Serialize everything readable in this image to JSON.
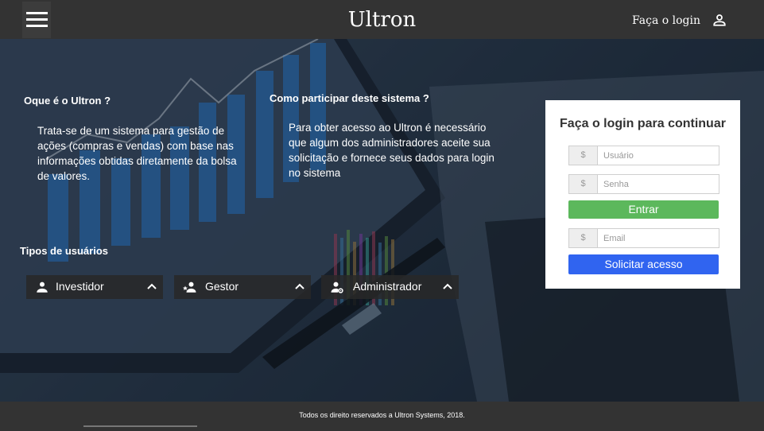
{
  "header": {
    "brand": "Ultron",
    "login_link": "Faça o login"
  },
  "info": {
    "what_title": "Oque é o Ultron ?",
    "what_text_lines": [
      "Trata-se de um sistema para gestão de",
      "ações (compras e vendas) com base nas",
      "informações obtidas diretamente da bolsa",
      "de valores."
    ],
    "how_title": "Como participar deste sistema ?",
    "how_text_lines": [
      "Para obter acesso ao Ultron é necessário",
      "que algum dos administradores aceite sua",
      "solicitação e fornece seus dados para login",
      "no sistema"
    ]
  },
  "user_types": {
    "title": "Tipos de usuários",
    "items": [
      {
        "label": "Investidor",
        "icon": "person-icon"
      },
      {
        "label": "Gestor",
        "icon": "person-star-icon"
      },
      {
        "label": "Administrador",
        "icon": "person-gear-icon"
      }
    ]
  },
  "login_card": {
    "title": "Faça o login para continuar",
    "addon_symbol": "$",
    "username_placeholder": "Usuário",
    "password_placeholder": "Senha",
    "enter_label": "Entrar",
    "email_placeholder": "Email",
    "request_label": "Solicitar acesso"
  },
  "footer": {
    "text": "Todos os direito reservados a Ultron Systems, 2018."
  },
  "colors": {
    "header_bg": "#333333",
    "enter_button": "#5cb85c",
    "request_button": "#3064f0",
    "card_bg": "#ffffff"
  }
}
